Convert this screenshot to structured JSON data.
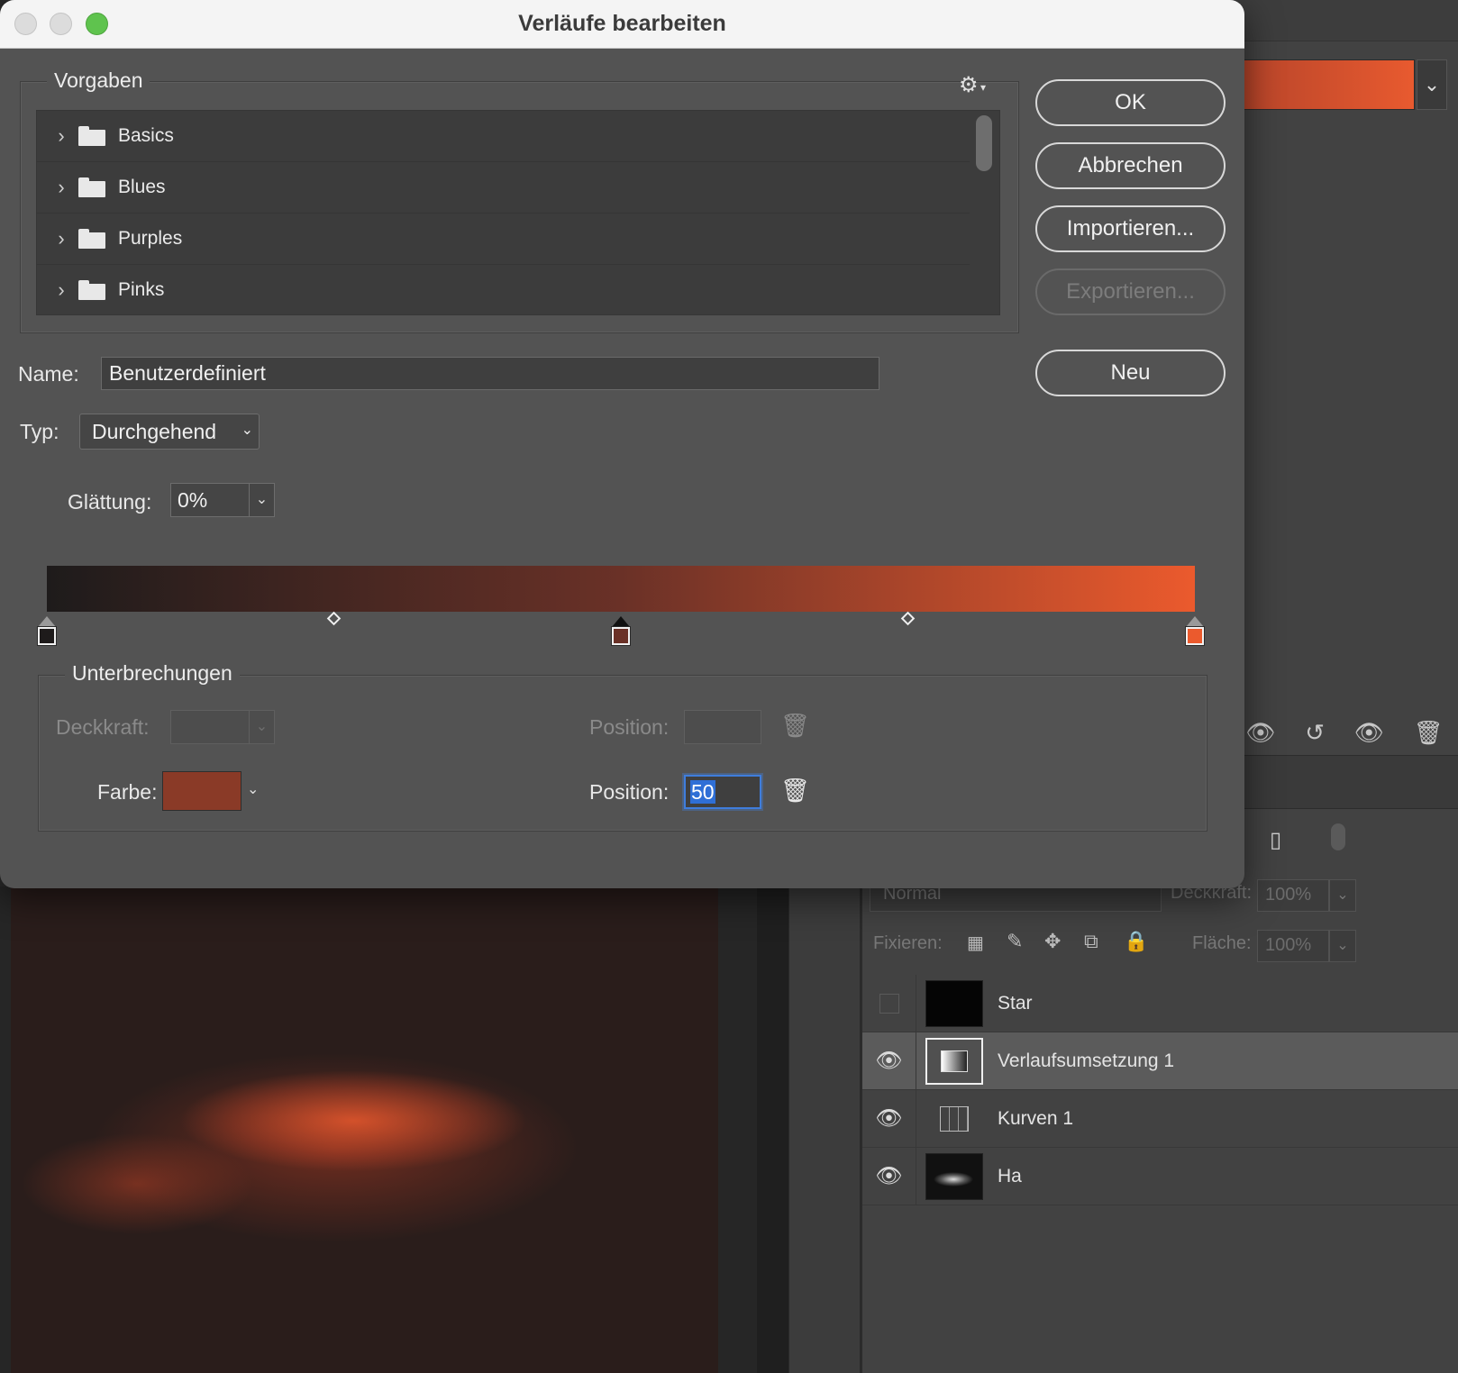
{
  "dialog": {
    "title": "Verläufe bearbeiten",
    "presets": {
      "legend": "Vorgaben",
      "gear_icon": "gear-icon",
      "items": [
        {
          "label": "Basics"
        },
        {
          "label": "Blues"
        },
        {
          "label": "Purples"
        },
        {
          "label": "Pinks"
        }
      ]
    },
    "buttons": {
      "ok": "OK",
      "cancel": "Abbrechen",
      "import": "Importieren...",
      "export": "Exportieren...",
      "new": "Neu"
    },
    "name": {
      "label": "Name:",
      "value": "Benutzerdefiniert"
    },
    "type": {
      "label": "Typ:",
      "value": "Durchgehend"
    },
    "smoothness": {
      "label": "Glättung:",
      "value": "0%"
    },
    "gradient": {
      "colors": [
        "#1e1b1b",
        "#6a3127",
        "#eb5a2d"
      ],
      "color_stops": [
        {
          "location": 0,
          "color": "#1e1b1b",
          "selected": false
        },
        {
          "location": 50,
          "color": "#6a3127",
          "selected": true
        },
        {
          "location": 100,
          "color": "#eb5a2d",
          "selected": false
        }
      ],
      "midpoints": [
        25,
        75
      ]
    },
    "stops": {
      "legend": "Unterbrechungen",
      "opacity_label": "Deckkraft:",
      "opacity_position_label": "Position:",
      "color_label": "Farbe:",
      "color_value": "#8a3a27",
      "color_position_label": "Position:",
      "color_position_value": "50"
    }
  },
  "layers": {
    "blend_mode": "Normal",
    "opacity_label": "Deckkraft:",
    "opacity_value": "100%",
    "lock_label": "Fixieren:",
    "fill_label": "Fläche:",
    "fill_value": "100%",
    "items": [
      {
        "name": "Star",
        "visible": false,
        "selected": false
      },
      {
        "name": "Verlaufsumsetzung 1",
        "visible": true,
        "selected": true
      },
      {
        "name": "Kurven 1",
        "visible": true,
        "selected": false
      },
      {
        "name": "Ha",
        "visible": true,
        "selected": false
      }
    ]
  }
}
